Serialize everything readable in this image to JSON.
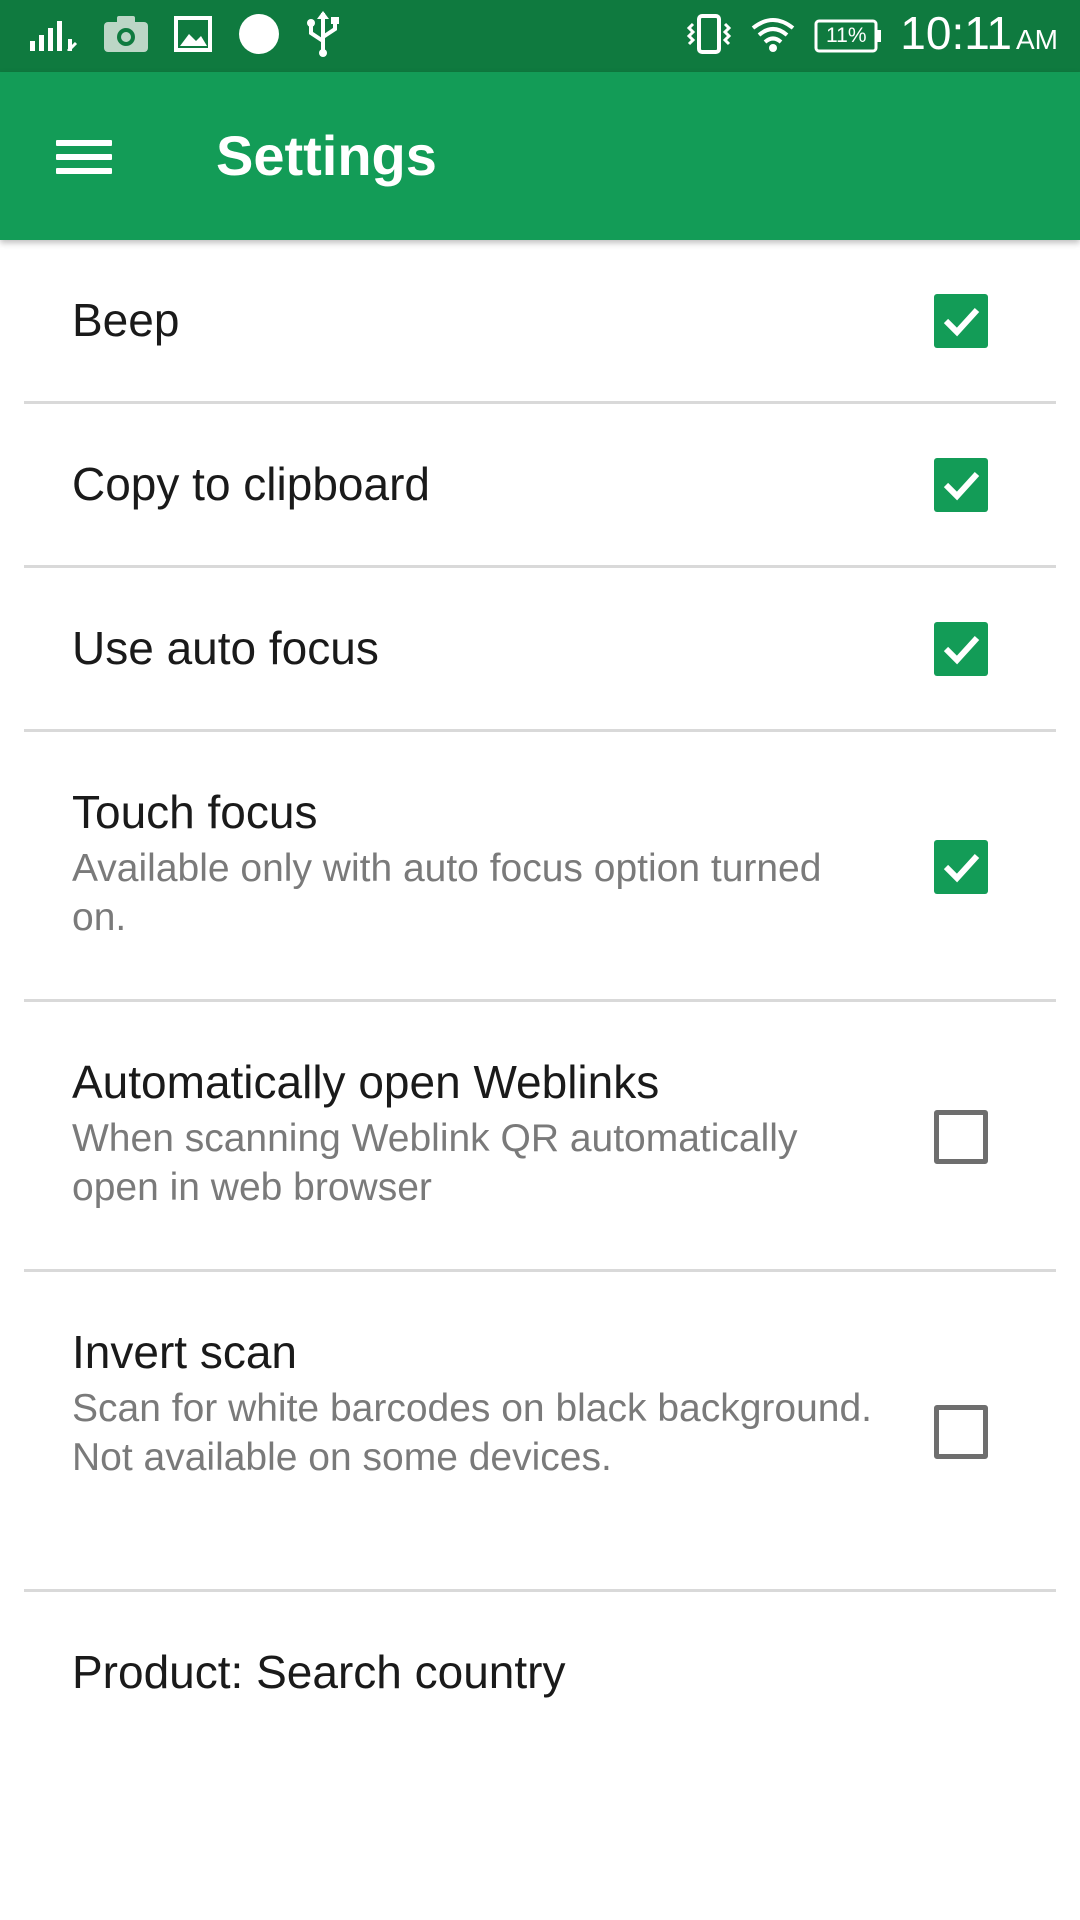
{
  "status_bar": {
    "battery": "11%",
    "time": "10:11",
    "ampm": "AM",
    "background": "#0f7a3f"
  },
  "app_bar": {
    "title": "Settings",
    "background": "#139c57",
    "menu_icon": "hamburger-icon"
  },
  "settings": {
    "items": [
      {
        "title": "Beep",
        "summary": "",
        "checked": true
      },
      {
        "title": "Copy to clipboard",
        "summary": "",
        "checked": true
      },
      {
        "title": "Use auto focus",
        "summary": "",
        "checked": true
      },
      {
        "title": "Touch focus",
        "summary": "Available only with auto focus option turned on.",
        "checked": true
      },
      {
        "title": "Automatically open Weblinks",
        "summary": "When scanning Weblink QR automatically open in web browser",
        "checked": false
      },
      {
        "title": "Invert scan",
        "summary": "Scan for white barcodes on black background. Not available on some devices.",
        "checked": false
      },
      {
        "title": "Product: Search country",
        "summary": ""
      }
    ]
  },
  "colors": {
    "accent": "#139c57",
    "divider": "#d9d9d9",
    "summary_text": "#7a7a7a"
  }
}
